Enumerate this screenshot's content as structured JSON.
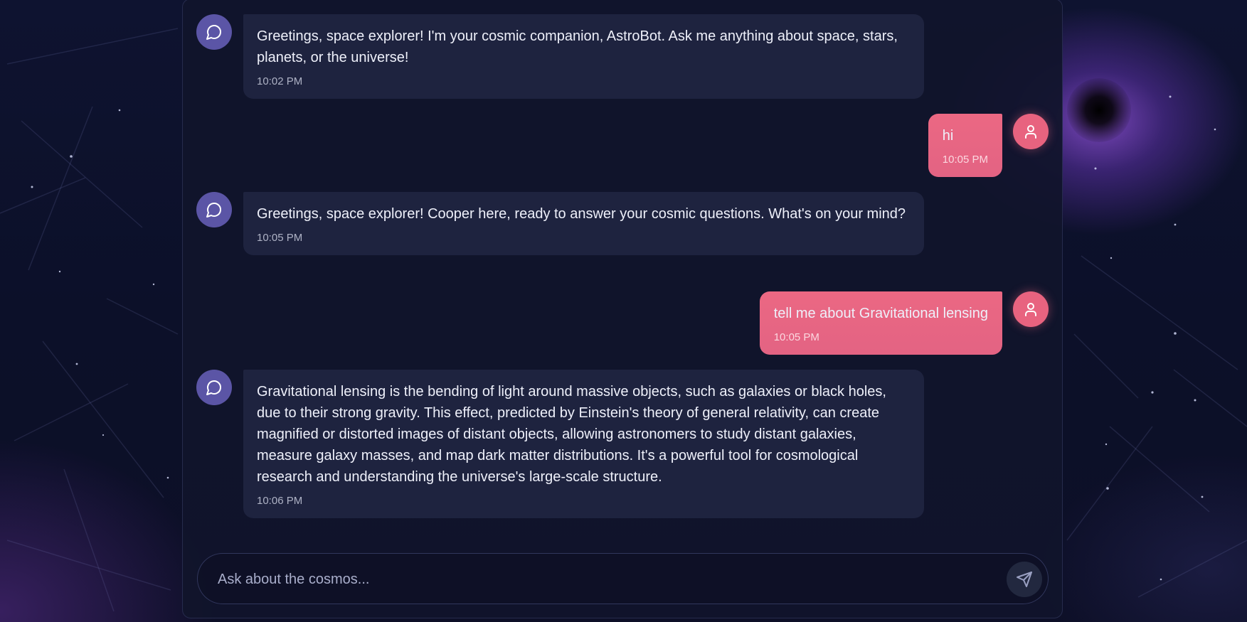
{
  "colors": {
    "bot_avatar": "#5b55a6",
    "user_bubble": "#e8637f",
    "bot_bubble": "#1e233f",
    "background": "#0c1029"
  },
  "messages": [
    {
      "sender": "bot",
      "icon": "chat-bubble-icon",
      "text": "Greetings, space explorer! I'm your cosmic companion, AstroBot. Ask me anything about space, stars, planets, or the universe!",
      "time": "10:02 PM"
    },
    {
      "sender": "user",
      "icon": "user-icon",
      "text": "hi",
      "time": "10:05 PM"
    },
    {
      "sender": "bot",
      "icon": "chat-bubble-icon",
      "text": "Greetings, space explorer! Cooper here, ready to answer your cosmic questions. What's on your mind?",
      "time": "10:05 PM"
    },
    {
      "sender": "user",
      "icon": "user-icon",
      "text": "tell me about Gravitational lensing",
      "time": "10:05 PM"
    },
    {
      "sender": "bot",
      "icon": "chat-bubble-icon",
      "text": "Gravitational lensing is the bending of light around massive objects, such as galaxies or black holes, due to their strong gravity. This effect, predicted by Einstein's theory of general relativity, can create magnified or distorted images of distant objects, allowing astronomers to study distant galaxies, measure galaxy masses, and map dark matter distributions. It's a powerful tool for cosmological research and understanding the universe's large-scale structure.",
      "time": "10:06 PM"
    }
  ],
  "composer": {
    "placeholder": "Ask about the cosmos...",
    "value": "",
    "send_icon": "send-icon"
  }
}
